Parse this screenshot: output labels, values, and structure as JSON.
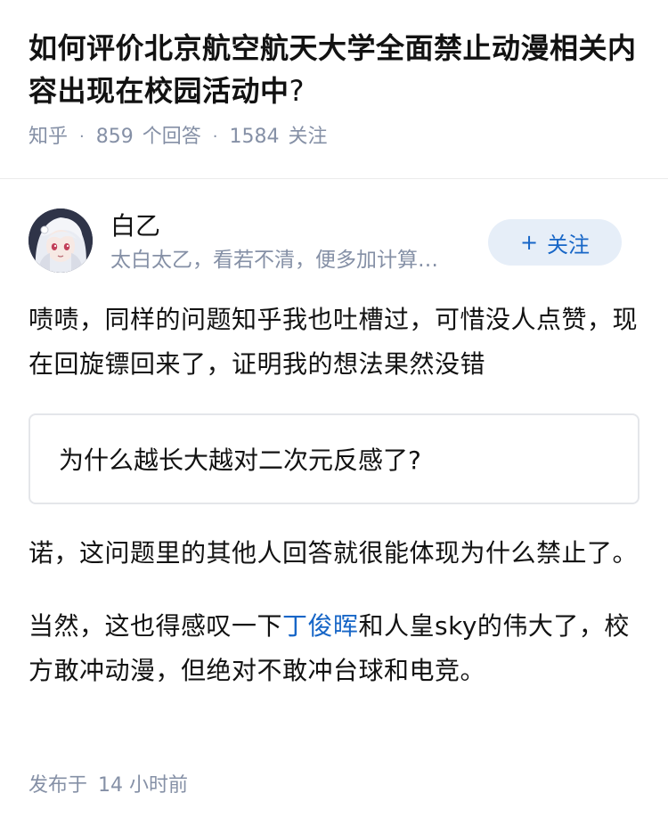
{
  "question": {
    "title": "如何评价北京航空航天大学全面禁止动漫相关内容出现在校园活动中",
    "title_qmark": "?",
    "source": "知乎",
    "answers_count": "859",
    "answers_label": "个回答",
    "followers_count": "1584",
    "followers_label": "关注",
    "meta_separator": "·"
  },
  "author": {
    "avatar_icon": "anime-avatar",
    "name": "白乙",
    "bio": "太白太乙，看若不清，便多加计算…",
    "follow_plus": "+",
    "follow_label": "关注"
  },
  "answer": {
    "paragraph1": "啧啧，同样的问题知乎我也吐槽过，可惜没人点赞，现在回旋镖回来了，证明我的想法果然没错",
    "linked_question": "为什么越长大越对二次元反感了?",
    "paragraph2": "诺，这问题里的其他人回答就很能体现为什么禁止了。",
    "paragraph3_before": "当然，这也得感叹一下",
    "paragraph3_link": "丁俊晖",
    "paragraph3_after": "和人皇sky的伟大了，校方敢冲动漫，但绝对不敢冲台球和电竞。",
    "published_label": "发布于",
    "published_time": "14 小时前"
  },
  "colors": {
    "link": "#1766c7",
    "meta_gray": "#8590a6",
    "follow_bg": "#e6eef8"
  }
}
